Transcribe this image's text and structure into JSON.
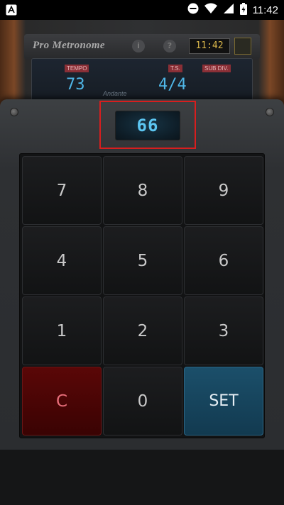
{
  "status_bar": {
    "time": "11:42",
    "left_icon": "a-notification-icon",
    "right_icons": [
      "do-not-disturb-icon",
      "wifi-icon",
      "cellular-signal-icon",
      "battery-icon"
    ]
  },
  "background_app": {
    "title": "Pro Metronome",
    "info_button": "i",
    "help_button": "?",
    "clock": "11:42",
    "folder_icon": "folder-icon",
    "display": {
      "tempo_label": "TEMPO",
      "tempo_value": "73",
      "tempo_marking": "Andante",
      "ts_label": "T.S.",
      "ts_value": "4/4",
      "subdiv_label": "SUB DIV."
    }
  },
  "keypad_dialog": {
    "display_value": "66",
    "keys": {
      "k7": "7",
      "k8": "8",
      "k9": "9",
      "k4": "4",
      "k5": "5",
      "k6": "6",
      "k1": "1",
      "k2": "2",
      "k3": "3",
      "clear": "C",
      "k0": "0",
      "set": "SET"
    }
  },
  "colors": {
    "highlight_border": "#d81e1e",
    "display_text": "#5cc6f2",
    "clear_key": "#4a0505",
    "set_key": "#184862"
  }
}
